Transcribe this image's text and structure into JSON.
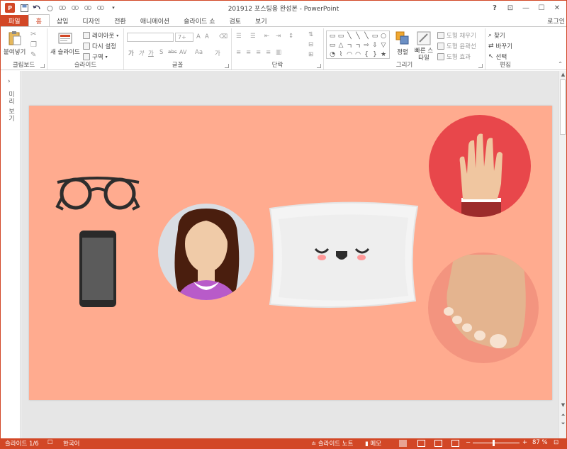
{
  "titlebar": {
    "app_icon": "P",
    "title": "201912 포스팅용 완성본 - PowerPoint",
    "qat": [
      "save-icon",
      "undo-icon",
      "redo-icon",
      "customize-icon"
    ],
    "controls": {
      "help": "?",
      "ribbon_opts": "⊡",
      "min": "—",
      "max": "☐",
      "close": "✕"
    }
  },
  "tabs": [
    {
      "id": "file",
      "label": "파일"
    },
    {
      "id": "home",
      "label": "홈"
    },
    {
      "id": "insert",
      "label": "삽입"
    },
    {
      "id": "design",
      "label": "디자인"
    },
    {
      "id": "transitions",
      "label": "전환"
    },
    {
      "id": "animations",
      "label": "애니메이션"
    },
    {
      "id": "slideshow",
      "label": "슬라이드 쇼"
    },
    {
      "id": "review",
      "label": "검토"
    },
    {
      "id": "view",
      "label": "보기"
    }
  ],
  "login": "로그인",
  "ribbon": {
    "clipboard": {
      "label": "클립보드",
      "paste": "붙여넣기"
    },
    "slides": {
      "label": "슬라이드",
      "new_slide": "새 슬라이드",
      "layout": "레이아웃",
      "reset": "다시 설정",
      "section": "구역"
    },
    "font": {
      "label": "글꼴",
      "size_placeholder": "7+",
      "formats": [
        "가",
        "가",
        "가",
        "S",
        "abc",
        "AV",
        "Aa",
        "가"
      ]
    },
    "paragraph": {
      "label": "단락"
    },
    "drawing": {
      "label": "그리기",
      "arrange": "정렬",
      "quick_styles": "빠른 스타일",
      "fill": "도형 채우기",
      "outline": "도형 윤곽선",
      "effects": "도형 효과"
    },
    "editing": {
      "label": "편집",
      "find": "찾기",
      "replace": "바꾸기",
      "select": "선택"
    },
    "shape_glyphs": [
      "▭",
      "▭",
      "╲",
      "╲",
      "╲",
      "▭",
      "○",
      "▭",
      "△",
      "ㄱ",
      "ㄱ",
      "⇨",
      "⇩",
      "▽",
      "◔",
      "⌇",
      "◠",
      "◠",
      "{",
      "}",
      "★"
    ]
  },
  "leftrail": {
    "label": "미리 보기"
  },
  "status": {
    "slide_index": "슬라이드 1/6",
    "language": "한국어",
    "notes": "슬라이드 노트",
    "comments": "메모",
    "zoom": "87 %",
    "zoom_level_pct": 87
  },
  "colors": {
    "accent": "#d24726",
    "slide_bg": "#ffab8f"
  }
}
